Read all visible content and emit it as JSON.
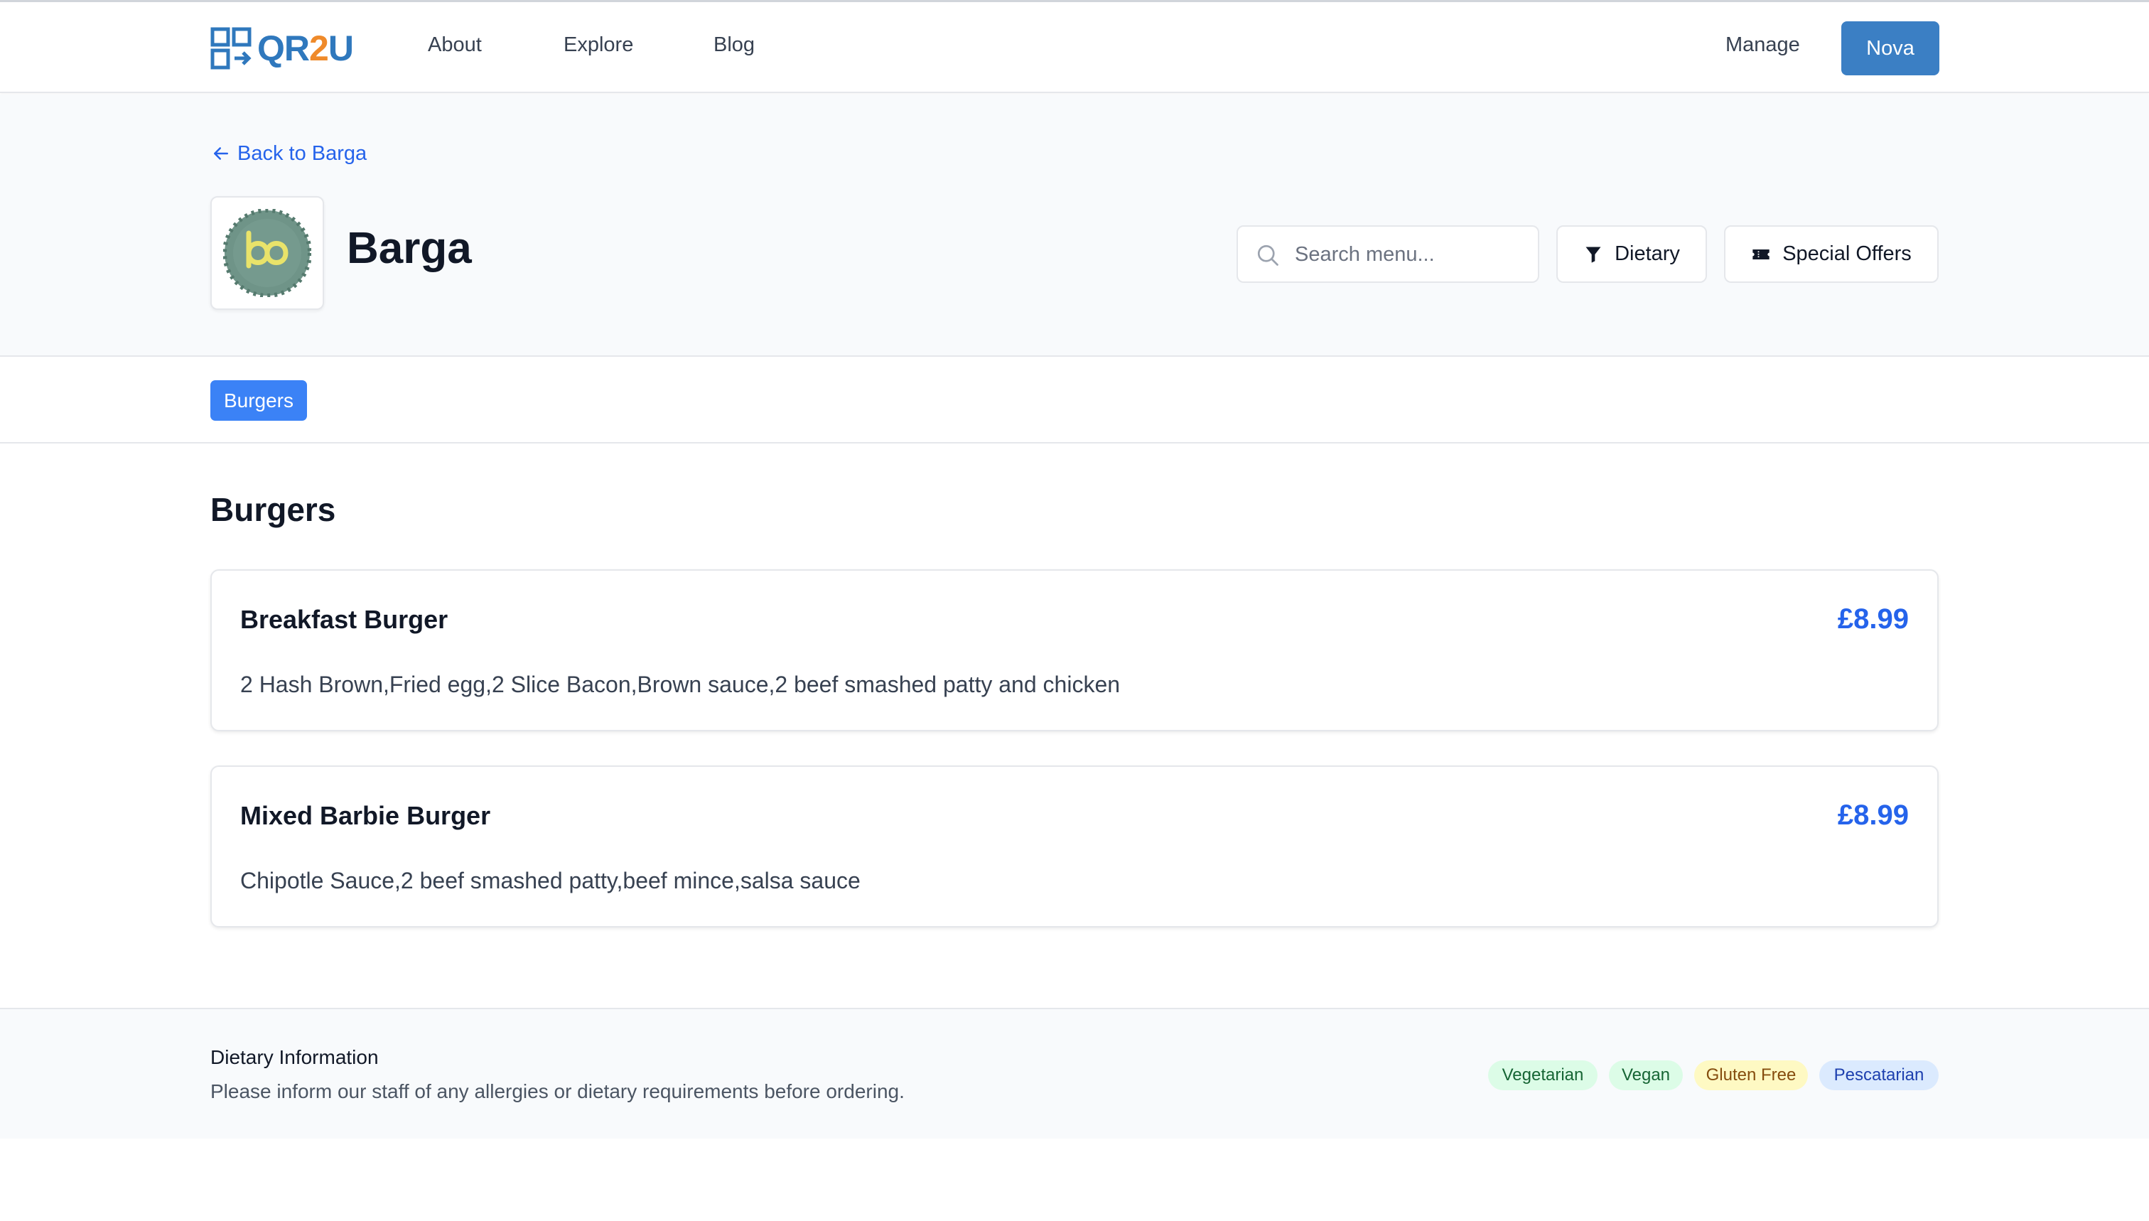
{
  "nav": {
    "logo": {
      "part1": "QR",
      "part2": "2",
      "part3": "U"
    },
    "links": {
      "about": "About",
      "explore": "Explore",
      "blog": "Blog",
      "manage": "Manage"
    },
    "user_button": "Nova"
  },
  "header": {
    "back_link": "Back to Barga",
    "restaurant_name": "Barga",
    "search": {
      "placeholder": "Search menu...",
      "value": ""
    },
    "dietary_button": "Dietary",
    "offers_button": "Special Offers"
  },
  "categories": [
    {
      "label": "Burgers",
      "active": true
    }
  ],
  "menu": {
    "section_title": "Burgers",
    "items": [
      {
        "name": "Breakfast Burger",
        "price": "£8.99",
        "description": "2 Hash Brown,Fried egg,2 Slice Bacon,Brown sauce,2 beef smashed patty and chicken"
      },
      {
        "name": "Mixed Barbie Burger",
        "price": "£8.99",
        "description": "Chipotle Sauce,2 beef smashed patty,beef mince,salsa sauce"
      }
    ]
  },
  "footer": {
    "title": "Dietary Information",
    "text": "Please inform our staff of any allergies or dietary requirements before ordering.",
    "tags": [
      "Vegetarian",
      "Vegan",
      "Gluten Free",
      "Pescatarian"
    ]
  },
  "colors": {
    "accent": "#3b82f6",
    "nav_button": "#3b7fc4",
    "price": "#2563eb",
    "logo_orange": "#ef8a2a"
  },
  "icons": {
    "back": "arrow-left-icon",
    "search": "search-icon",
    "dietary": "filter-icon",
    "offers": "ticket-icon"
  }
}
